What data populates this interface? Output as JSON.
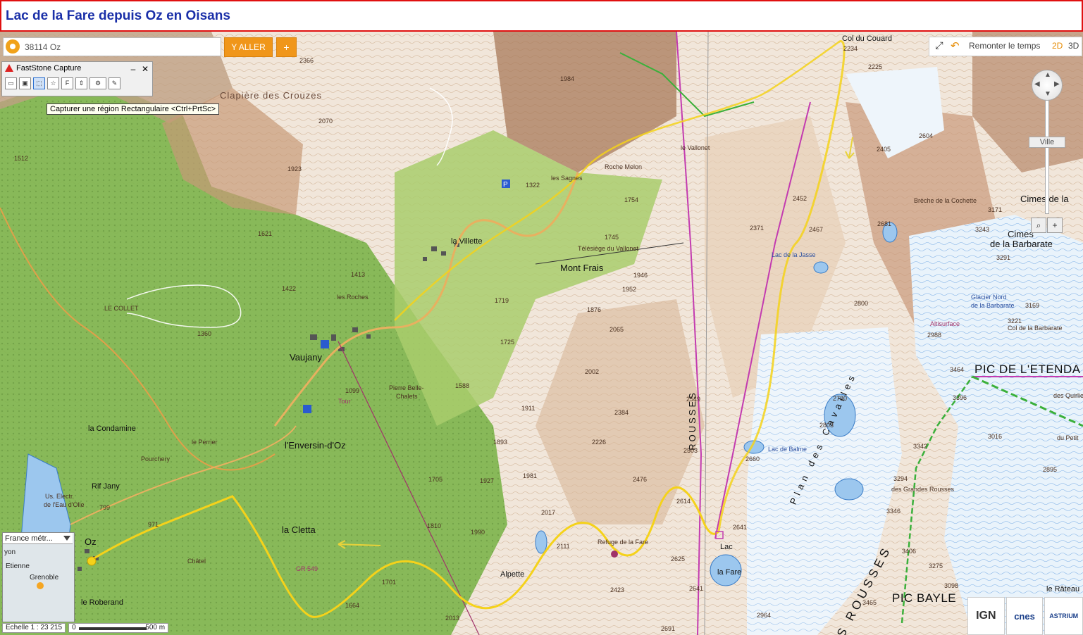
{
  "page": {
    "title": "Lac de la Fare depuis Oz en Oisans"
  },
  "search": {
    "value": "38114 Oz",
    "go_label": "Y ALLER",
    "plus_label": "+"
  },
  "faststone": {
    "title": "FastStone Capture",
    "minimize": "–",
    "close": "✕",
    "tooltip": "Capturer une région Rectangulaire <Ctrl+PrtSc>"
  },
  "toolbar": {
    "fullscreen_icon": "fullscreen-icon",
    "undo_icon": "undo-arrow-icon",
    "remonter_label": "Remonter le temps",
    "mode_2d": "2D",
    "mode_3d": "3D"
  },
  "navigation": {
    "zoom_tag": "Ville",
    "zoom_in": "+",
    "zoom_magnifier": "magnifier-icon"
  },
  "overview": {
    "select_value": "France métr...",
    "cities": [
      "yon",
      "Etienne",
      "Grenoble"
    ]
  },
  "scale": {
    "ratio": "Echelle 1 : 23 215",
    "zero": "0",
    "distance": "500 m"
  },
  "logos": [
    "IGN",
    "cnes",
    "ASTRIUM"
  ],
  "map": {
    "places": {
      "vaujany": "Vaujany",
      "la_villette": "la Villette",
      "enversin": "l'Enversin-d'Oz",
      "oz": "Oz",
      "le_roberand": "le Roberand",
      "mont_frais": "Mont Frais",
      "lac_fare": "Lac",
      "lac_fare2": "la Fare",
      "refuge": "Refuge de la Fare",
      "alpette": "Alpette",
      "la_cletta": "la Cletta",
      "le_collet": "LE COLLET",
      "col_couard": "Col du Couard",
      "cimes_barbarate": "Cimes",
      "cimes_barbarate2": "de la Barbarate",
      "cimes_la": "Cimes de la",
      "pic_etendard": "PIC DE L'ETENDA",
      "pic_bayle": "PIC BAYLE",
      "rateau": "le Râteau",
      "la_condamine": "la Condamine",
      "pourchery": "Pourchery",
      "rif_jany": "Rif Jany",
      "clapiere": "Clapière des Crouzes",
      "le_vallonet": "le Vallonet",
      "roche_melon": "Roche Melon",
      "les_sagnes": "les Sagnes",
      "les_roches": "les Roches",
      "pierre_belle": "Pierre Belle-",
      "pierre_belle2": "Chalets",
      "breche_cochette": "Brèche de la Cochette",
      "col_barbarate": "Col de la Barbarate",
      "glacier_nord": "Glacier Nord",
      "glacier_nord2": "de la Barbarate",
      "lac_jasse": "Lac de la Jasse",
      "lac_balme": "Lac de Balme",
      "telesiege": "Télésiège du Vallonet",
      "le_perrier": "le Perrier",
      "chatel": "Châtel",
      "grandes_rousses": "des Grandes Rousses",
      "rousses": "ROUSSES",
      "des_rousses": "DES ROUSSES",
      "plan_cavalles": "Plan des Cavalles",
      "altisurface": "Altisurface",
      "us_electr": "Us. Electr.",
      "de_eau_olle": "de l'Eau d'Olle",
      "le_gaz": "GR 549",
      "tour": "Tour",
      "les_oulles": "des Quirlies",
      "du_petit": "du Petit"
    },
    "elevations": [
      "2234",
      "2225",
      "1512",
      "1923",
      "1621",
      "1754",
      "1745",
      "1946",
      "1952",
      "1876",
      "2065",
      "2002",
      "2384",
      "2226",
      "2476",
      "2614",
      "2641",
      "2625",
      "2111",
      "2017",
      "1990",
      "1981",
      "1927",
      "1893",
      "1911",
      "1725",
      "1719",
      "1588",
      "1099",
      "971",
      "799",
      "1705",
      "1810",
      "1701",
      "2013",
      "2423",
      "2691",
      "2641",
      "2964",
      "3171",
      "3243",
      "3291",
      "3169",
      "3221",
      "3464",
      "3396",
      "3342",
      "3294",
      "3346",
      "3406",
      "3275",
      "3098",
      "3465",
      "2800",
      "2780",
      "2803",
      "2452",
      "2467",
      "2371",
      "2405",
      "2604",
      "2681",
      "2988",
      "3016",
      "2895",
      "2660",
      "2549",
      "2503",
      "1664",
      "1413",
      "1322",
      "1360",
      "1422",
      "2070",
      "2366",
      "1984"
    ]
  }
}
